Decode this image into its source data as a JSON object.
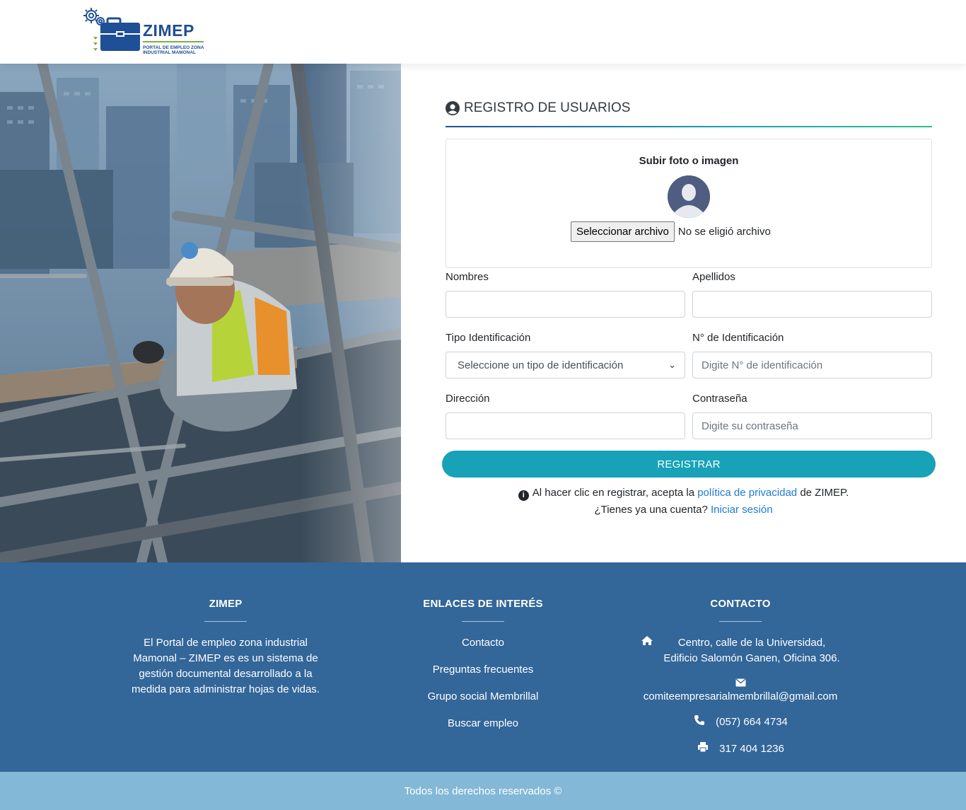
{
  "brand": {
    "name": "ZIMEP",
    "subtitle": "PORTAL DE EMPLEO ZONA INDUSTRIAL MAMONAL",
    "colors": {
      "primary": "#1f4f94",
      "accent_green": "#7bb342",
      "teal": "#17a2b8",
      "footer": "#336699",
      "footer_bottom": "#83b8d7"
    }
  },
  "form": {
    "title": "REGISTRO DE USUARIOS",
    "upload": {
      "title": "Subir foto o imagen",
      "button_label": "Seleccionar archivo",
      "status": "No se eligió archivo"
    },
    "fields": {
      "nombres": {
        "label": "Nombres",
        "placeholder": ""
      },
      "apellidos": {
        "label": "Apellidos",
        "placeholder": ""
      },
      "tipo_id": {
        "label": "Tipo Identificación",
        "selected": "Seleccione un tipo de identificación"
      },
      "num_id": {
        "label": "N° de Identificación",
        "placeholder": "Digite N° de identificación"
      },
      "direccion": {
        "label": "Dirección",
        "placeholder": ""
      },
      "contrasena": {
        "label": "Contraseña",
        "placeholder": "Digite su contraseña"
      }
    },
    "submit_label": "REGISTRAR",
    "privacy": {
      "prefix": "Al hacer clic en registrar, acepta la",
      "link": "política de privacidad",
      "suffix": "de ZIMEP."
    },
    "login": {
      "prefix": "¿Tienes ya una cuenta?",
      "link": "Iniciar sesión"
    }
  },
  "footer": {
    "about": {
      "title": "ZIMEP",
      "text": "El Portal de empleo zona industrial Mamonal – ZIMEP es es un sistema de gestión documental desarrollado a la medida para administrar hojas de vidas."
    },
    "links": {
      "title": "ENLACES DE INTERÉS",
      "items": [
        "Contacto",
        "Preguntas frecuentes",
        "Grupo social Membrillal",
        "Buscar empleo"
      ]
    },
    "contact": {
      "title": "CONTACTO",
      "address_line1": "Centro, calle de la Universidad,",
      "address_line2": "Edificio Salomón Ganen, Oficina 306.",
      "email": "comiteempresarialmembrillal@gmail.com",
      "phone": "(057) 664 4734",
      "fax": "317 404 1236"
    },
    "copyright": "Todos los derechos reservados ©"
  }
}
